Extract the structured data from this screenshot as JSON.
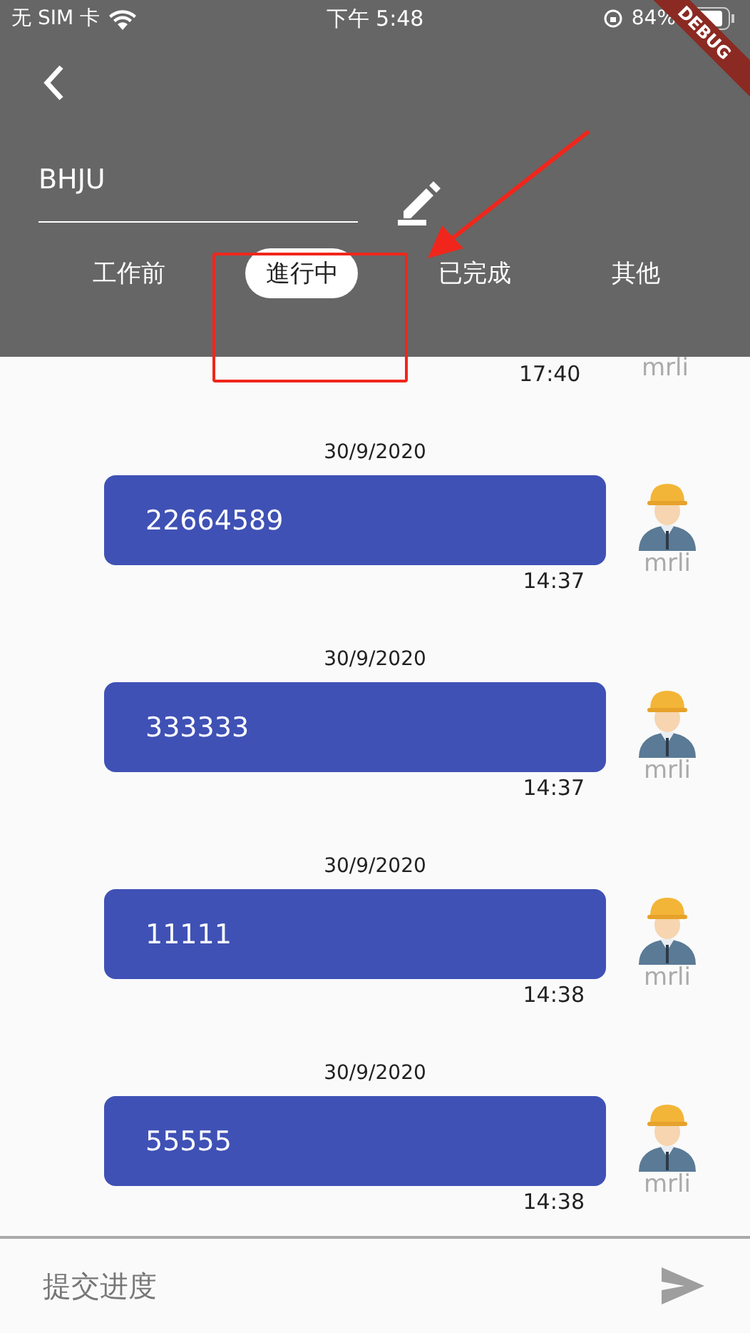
{
  "status_bar": {
    "carrier": "无 SIM 卡",
    "time": "下午 5:48",
    "battery": "84%"
  },
  "debug_banner": "DEBUG",
  "header": {
    "title_field": {
      "value": "BHJU"
    }
  },
  "tabs": [
    {
      "label": "工作前",
      "selected": false
    },
    {
      "label": "進行中",
      "selected": true
    },
    {
      "label": "已完成",
      "selected": false
    },
    {
      "label": "其他",
      "selected": false
    }
  ],
  "messages": [
    {
      "kind": "partial",
      "time": "17:40",
      "author": "mrli"
    },
    {
      "kind": "full",
      "date": "30/9/2020",
      "text": "22664589",
      "time": "14:37",
      "author": "mrli"
    },
    {
      "kind": "full",
      "date": "30/9/2020",
      "text": "333333",
      "time": "14:37",
      "author": "mrli"
    },
    {
      "kind": "full",
      "date": "30/9/2020",
      "text": "11111",
      "time": "14:38",
      "author": "mrli"
    },
    {
      "kind": "full",
      "date": "30/9/2020",
      "text": "55555",
      "time": "14:38",
      "author": "mrli"
    }
  ],
  "composer": {
    "placeholder": "提交进度"
  }
}
